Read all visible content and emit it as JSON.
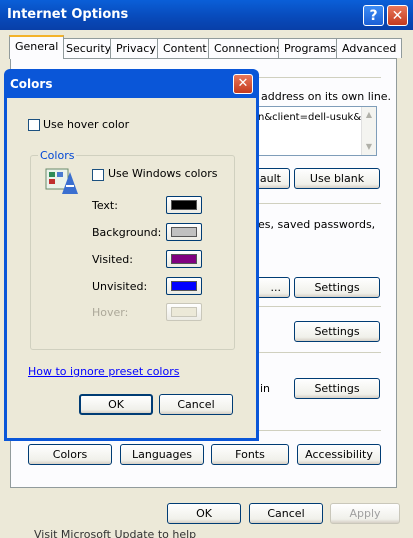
{
  "window": {
    "title": "Internet Options",
    "help_label": "?",
    "close_label": "✕"
  },
  "tabs": [
    "General",
    "Security",
    "Privacy",
    "Content",
    "Connections",
    "Programs",
    "Advanced"
  ],
  "general": {
    "home_text": "address on its own line.",
    "url_value": "n&client=dell-usuk&",
    "use_default_label": "ault",
    "use_blank_label": "Use blank",
    "history_text": "es, saved passwords,",
    "delete_label": "...",
    "settings1": "Settings",
    "settings2": "Settings",
    "tabs_text": "in",
    "settings3": "Settings",
    "colors_label": "Colors",
    "languages_label": "Languages",
    "fonts_label": "Fonts",
    "accessibility_label": "Accessibility",
    "ok_label": "OK",
    "cancel_label": "Cancel",
    "apply_label": "Apply"
  },
  "colors_dialog": {
    "title": "Colors",
    "close_label": "✕",
    "use_hover_label": "Use hover color",
    "group_label": "Colors",
    "use_windows_label": "Use Windows colors",
    "rows": [
      {
        "label": "Text:",
        "color": "#000000",
        "disabled": false
      },
      {
        "label": "Background:",
        "color": "#c0c0c0",
        "disabled": false
      },
      {
        "label": "Visited:",
        "color": "#800080",
        "disabled": false
      },
      {
        "label": "Unvisited:",
        "color": "#0000ff",
        "disabled": false
      },
      {
        "label": "Hover:",
        "color": "#ece9d8",
        "disabled": true
      }
    ],
    "link_label": "How to ignore preset colors",
    "ok_label": "OK",
    "cancel_label": "Cancel"
  },
  "bottom_text": "Visit Microsoft Update to help"
}
